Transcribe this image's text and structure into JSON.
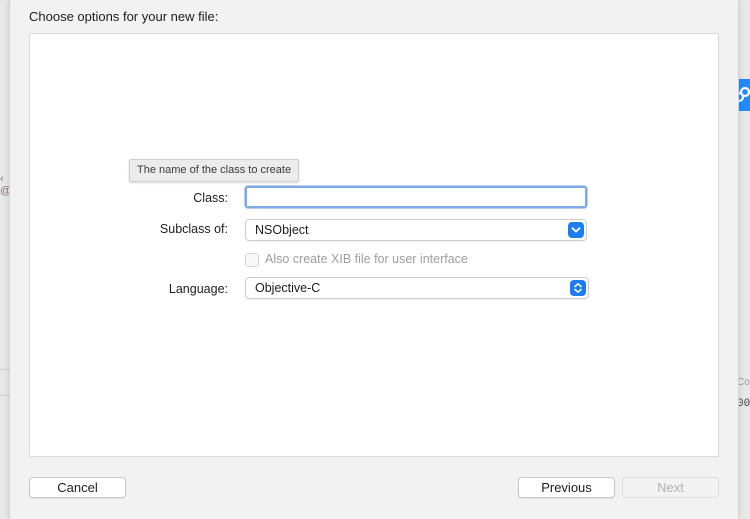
{
  "dialog": {
    "title": "Choose options for your new file:"
  },
  "tooltip": "The name of the class to create",
  "form": {
    "class_label": "Class:",
    "class_value": "",
    "subclass_label": "Subclass of:",
    "subclass_value": "NSObject",
    "xib_label": "Also create XIB file for user interface",
    "xib_checked": false,
    "language_label": "Language:",
    "language_value": "Objective-C"
  },
  "buttons": {
    "cancel": "Cancel",
    "previous": "Previous",
    "next": "Next"
  },
  "background": {
    "right_fragment_1": "Co",
    "right_fragment_2": "00",
    "left_fragment": "@e"
  },
  "colors": {
    "accent": "#1b7cf4",
    "focus_ring": "#7ea9e8"
  }
}
